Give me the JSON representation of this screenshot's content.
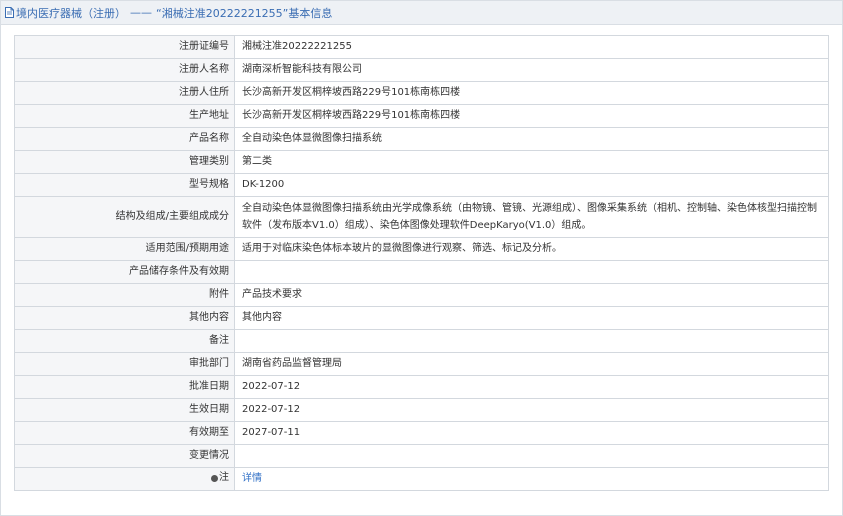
{
  "header": {
    "section": "境内医疗器械（注册）",
    "separator": "——",
    "record_title": "“湘械注准20222221255”基本信息"
  },
  "rows": [
    {
      "label": "注册证编号",
      "value": "湘械注准20222221255"
    },
    {
      "label": "注册人名称",
      "value": "湖南深析智能科技有限公司"
    },
    {
      "label": "注册人住所",
      "value": "长沙高新开发区桐梓坡西路229号101栋南栋四楼"
    },
    {
      "label": "生产地址",
      "value": "长沙高新开发区桐梓坡西路229号101栋南栋四楼"
    },
    {
      "label": "产品名称",
      "value": "全自动染色体显微图像扫描系统"
    },
    {
      "label": "管理类别",
      "value": "第二类"
    },
    {
      "label": "型号规格",
      "value": "DK-1200"
    },
    {
      "label": "结构及组成/主要组成成分",
      "value": "全自动染色体显微图像扫描系统由光学成像系统（由物镜、管镜、光源组成）、图像采集系统（相机、控制轴、染色体核型扫描控制软件（发布版本V1.0）组成）、染色体图像处理软件DeepKaryo(V1.0）组成。"
    },
    {
      "label": "适用范围/预期用途",
      "value": "适用于对临床染色体标本玻片的显微图像进行观察、筛选、标记及分析。"
    },
    {
      "label": "产品储存条件及有效期",
      "value": ""
    },
    {
      "label": "附件",
      "value": "产品技术要求"
    },
    {
      "label": "其他内容",
      "value": "其他内容"
    },
    {
      "label": "备注",
      "value": ""
    },
    {
      "label": "审批部门",
      "value": "湖南省药品监督管理局"
    },
    {
      "label": "批准日期",
      "value": "2022-07-12"
    },
    {
      "label": "生效日期",
      "value": "2022-07-12"
    },
    {
      "label": "有效期至",
      "value": "2027-07-11"
    },
    {
      "label": "变更情况",
      "value": ""
    }
  ],
  "note_row": {
    "label": "注",
    "link_text": "详情"
  },
  "colors": {
    "accent": "#3a6db3",
    "link": "#2f6fc6",
    "label_bg": "#f5f6f8",
    "border": "#d3d8de"
  }
}
